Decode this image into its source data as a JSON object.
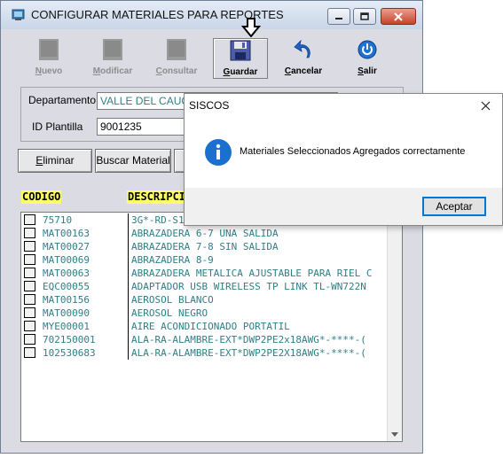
{
  "window": {
    "title": "CONFIGURAR MATERIALES PARA REPORTES"
  },
  "toolbar": [
    {
      "label_u": "N",
      "label_rest": "uevo",
      "enabled": false,
      "icon": "new-icon"
    },
    {
      "label_u": "M",
      "label_rest": "odificar",
      "enabled": false,
      "icon": "edit-icon"
    },
    {
      "label_u": "C",
      "label_rest": "onsultar",
      "enabled": false,
      "icon": "query-icon"
    },
    {
      "label_u": "G",
      "label_rest": "uardar",
      "enabled": true,
      "icon": "floppy-disk-icon"
    },
    {
      "label_u": "C",
      "label_rest": "ancelar",
      "enabled": true,
      "icon": "undo-arrow-icon"
    },
    {
      "label_u": "S",
      "label_rest": "alir",
      "enabled": true,
      "icon": "power-icon"
    }
  ],
  "form": {
    "departamento_label": "Departamento",
    "departamento_value": "VALLE DEL CAUCA",
    "plantilla_label": "ID Plantilla",
    "plantilla_value": "9001235"
  },
  "buttons": {
    "eliminar": "Eliminar",
    "buscar": "Buscar Material"
  },
  "columns": {
    "codigo": "CODIGO",
    "descripcion": "DESCRIPCI"
  },
  "rows": [
    {
      "code": "75710",
      "desc": "3G*-RD-S1"
    },
    {
      "code": "MAT00163",
      "desc": "ABRAZADERA 6-7 UNA SALIDA"
    },
    {
      "code": "MAT00027",
      "desc": "ABRAZADERA 7-8 SIN SALIDA"
    },
    {
      "code": "MAT00069",
      "desc": "ABRAZADERA 8-9"
    },
    {
      "code": "MAT00063",
      "desc": "ABRAZADERA METALICA AJUSTABLE PARA RIEL C"
    },
    {
      "code": "EQC00055",
      "desc": "ADAPTADOR USB WIRELESS  TP LINK TL-WN722N"
    },
    {
      "code": "MAT00156",
      "desc": "AEROSOL BLANCO"
    },
    {
      "code": "MAT00090",
      "desc": "AEROSOL NEGRO"
    },
    {
      "code": "MYE00001",
      "desc": "AIRE ACONDICIONADO PORTATIL"
    },
    {
      "code": "702150001",
      "desc": "ALA-RA-ALAMBRE-EXT*DWP2PE2x18AWG*-****-("
    },
    {
      "code": "102530683",
      "desc": "ALA-RA-ALAMBRE-EXT*DWP2PE2X18AWG*-****-("
    }
  ],
  "dialog": {
    "title": "SISCOS",
    "message": "Materiales Seleccionados Agregados correctamente",
    "ok_button": "Aceptar"
  },
  "colors": {
    "teal_text": "#2f7f87",
    "header_highlight": "#ffff66",
    "accent_blue": "#0078d7"
  }
}
